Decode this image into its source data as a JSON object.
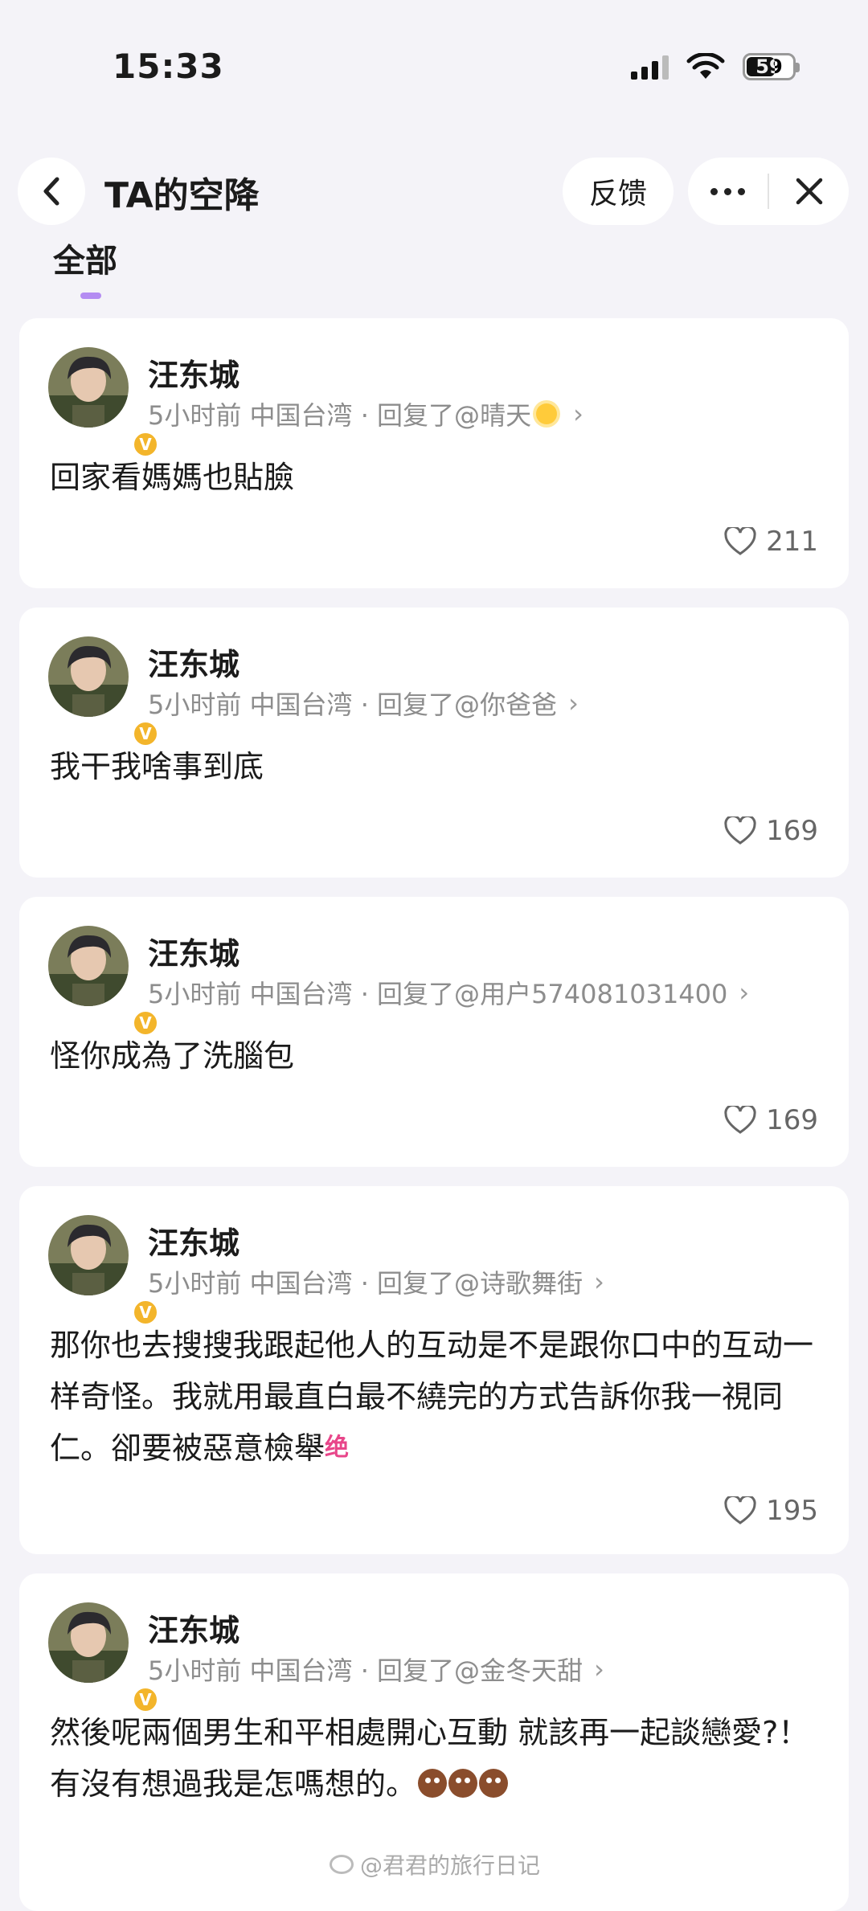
{
  "status_bar": {
    "time": "15:33",
    "battery": "59"
  },
  "header": {
    "title": "TA的空降",
    "feedback_label": "反馈"
  },
  "tabs": [
    {
      "label": "全部"
    }
  ],
  "posts": [
    {
      "author": "汪东城",
      "meta_prefix": "5小时前 中国台湾 · 回复了@",
      "reply_to": "晴天",
      "reply_suffix_icon": "sun-emoji",
      "content": "回家看媽媽也貼臉",
      "likes": "211"
    },
    {
      "author": "汪东城",
      "meta_prefix": "5小时前 中国台湾 · 回复了@",
      "reply_to": "你爸爸",
      "content": "我干我啥事到底",
      "likes": "169"
    },
    {
      "author": "汪东城",
      "meta_prefix": "5小时前 中国台湾 · 回复了@",
      "reply_to": "用户574081031400",
      "content": "怪你成為了洗腦包",
      "likes": "169"
    },
    {
      "author": "汪东城",
      "meta_prefix": "5小时前 中国台湾 · 回复了@",
      "reply_to": "诗歌舞街",
      "content": "那你也去搜搜我跟起他人的互动是不是跟你口中的互动一样奇怪。我就用最直白最不繞完的方式告訴你我一視同仁。卻要被惡意檢舉",
      "content_tag": "绝",
      "likes": "195"
    },
    {
      "author": "汪东城",
      "meta_prefix": "5小时前 中国台湾 · 回复了@",
      "reply_to": "金冬天甜",
      "content": "然後呢兩個男生和平相處開心互動 就該再一起談戀愛?！有沒有想過我是怎嗎想的。",
      "content_emoji": "poop-emoji x3"
    }
  ],
  "watermark": {
    "text": "@君君的旅行日记"
  },
  "colors": {
    "background": "#f4f3f8",
    "accent": "#b48cf2",
    "verified": "#f3b52b",
    "meta": "#8d8d8d"
  }
}
